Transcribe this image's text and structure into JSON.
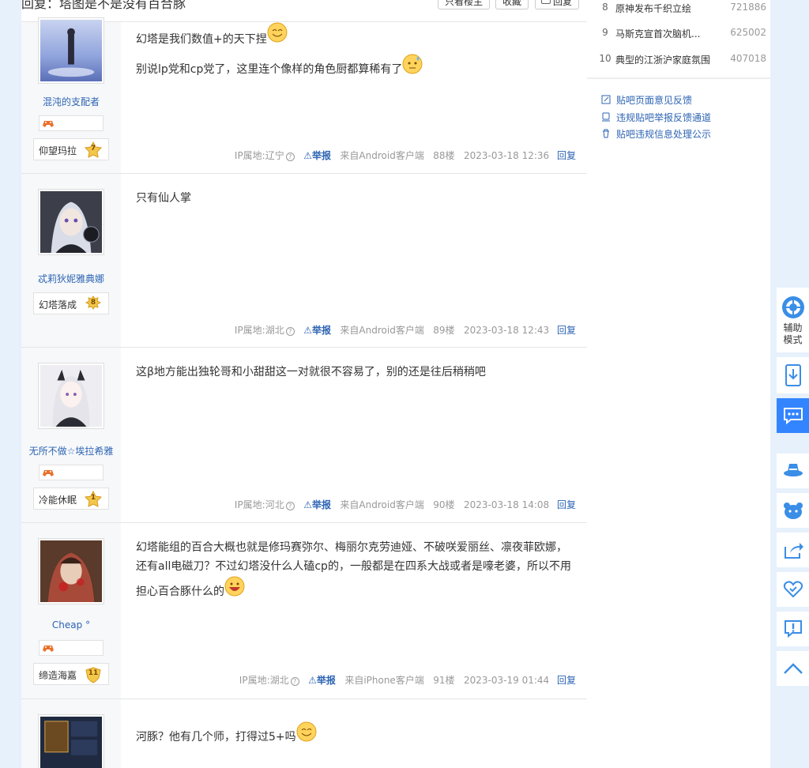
{
  "header": {
    "title": "回复：塔图是不是没有百合豚",
    "btn_only_owner": "只看楼主",
    "btn_collect": "收藏",
    "btn_reply": "回复"
  },
  "posts": [
    {
      "username": "混沌的支配者",
      "level_name": "仰望玛拉",
      "level": "7",
      "has_game_badge": true,
      "lines": [
        "幻塔是我们数值+的天下捏",
        "别说lp党和cp党了，这里连个像样的角色厨都算稀有了"
      ],
      "ip": "IP属地:辽宁",
      "report": "举报",
      "client": "来自Android客户端",
      "floor": "88楼",
      "time": "2023-03-18 12:36",
      "reply": "回复"
    },
    {
      "username": "忒莉狄妮雅典娜",
      "level_name": "幻塔落成",
      "level": "8",
      "has_game_badge": false,
      "lines": [
        "只有仙人掌"
      ],
      "ip": "IP属地:湖北",
      "report": "举报",
      "client": "来自Android客户端",
      "floor": "89楼",
      "time": "2023-03-18 12:43",
      "reply": "回复"
    },
    {
      "username": "无所不做☆埃拉希雅",
      "level_name": "冷能休眠",
      "level": "1",
      "has_game_badge": true,
      "lines": [
        "这β地方能出独轮哥和小甜甜这一对就很不容易了，别的还是往后稍稍吧"
      ],
      "ip": "IP属地:河北",
      "report": "举报",
      "client": "来自Android客户端",
      "floor": "90楼",
      "time": "2023-03-18 14:08",
      "reply": "回复"
    },
    {
      "username": "Cheap °",
      "level_name": "缔造海嘉",
      "level": "11",
      "has_game_badge": true,
      "lines": [
        "幻塔能组的百合大概也就是修玛赛弥尔、梅丽尔克劳迪娅、不破咲爱丽丝、凛夜菲欧娜，还有all电磁刀？不过幻塔没什么人磕cp的，一般都是在四系大战或者是嚎老婆，所以不用担心百合豚什么的"
      ],
      "ip": "IP属地:湖北",
      "report": "举报",
      "client": "来自iPhone客户端",
      "floor": "91楼",
      "time": "2023-03-19 01:44",
      "reply": "回复"
    },
    {
      "lines": [
        "河豚？他有几个师，打得过5+吗"
      ]
    }
  ],
  "sidebar": {
    "hot": [
      {
        "rank": "8",
        "title": "原神发布千织立绘",
        "count": "721886"
      },
      {
        "rank": "9",
        "title": "马斯克宣首次脑机...",
        "count": "625002"
      },
      {
        "rank": "10",
        "title": "典型的江浙沪家庭氛围",
        "count": "407018"
      }
    ],
    "feedback_links": [
      "贴吧页面意见反馈",
      "违规贴吧举报反馈通道",
      "贴吧违规信息处理公示"
    ]
  },
  "toolbar": {
    "assist_mode": "辅助模式",
    "assist_line1": "辅助",
    "assist_line2": "模式"
  },
  "colors": {
    "link_blue": "#2d64b3",
    "page_bg": "#e6f1fc",
    "active_tool": "#3385ff",
    "tool_icon": "#3a8ee6"
  }
}
